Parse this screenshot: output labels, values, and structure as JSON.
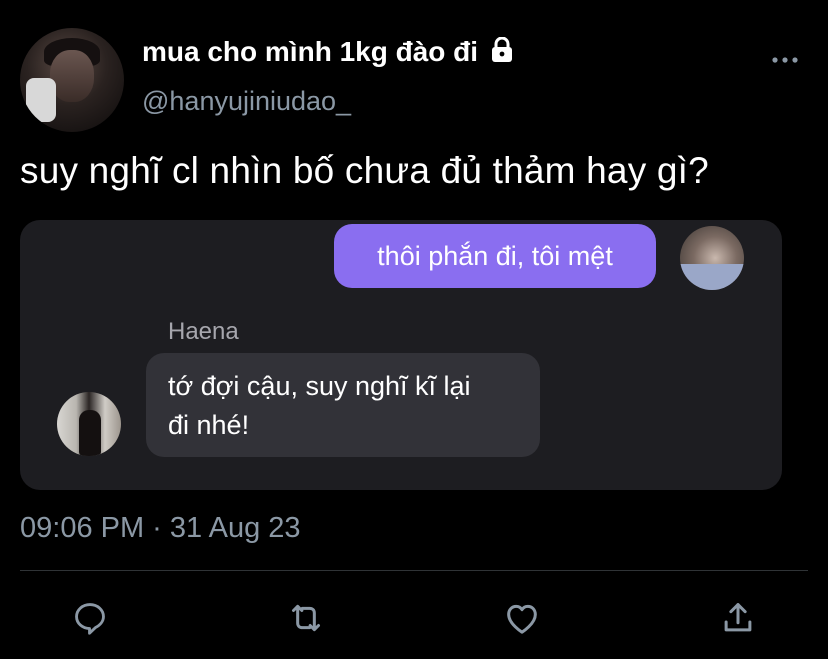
{
  "tweet": {
    "display_name": "mua cho mình 1kg đào đi",
    "handle": "@hanyujiniudao_",
    "text": "suy nghĩ cl nhìn bố chưa đủ thảm hay gì?",
    "timestamp": "09:06 PM · 31 Aug 23"
  },
  "chat_card": {
    "outgoing_message": "thôi phắn đi, tôi mệt",
    "incoming_sender": "Haena",
    "incoming_message_lines": [
      "tớ đợi cậu, suy nghĩ kĩ lại",
      "đi nhé!"
    ]
  },
  "icons": {
    "lock": "lock-icon",
    "more": "more-icon",
    "actions": [
      "reply-icon",
      "retweet-icon",
      "like-icon",
      "share-icon"
    ]
  },
  "colors": {
    "background": "#000000",
    "secondary_text": "#8b98a5",
    "card_bg": "#1d1d21",
    "outgoing_bubble": "#8a6ef0",
    "incoming_bubble": "#323238"
  }
}
